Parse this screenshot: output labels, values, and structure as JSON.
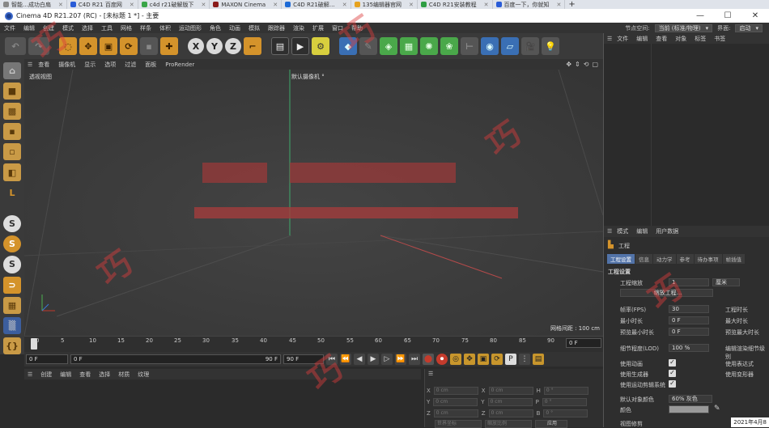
{
  "browser_tabs": [
    {
      "label": "智能…成功白扇",
      "color": "#888"
    },
    {
      "label": "C4D R21 百度网",
      "color": "#2a5cd7"
    },
    {
      "label": "c4d r21破解版下",
      "color": "#3aa548"
    },
    {
      "label": "MAXON Cinema",
      "color": "#8a1c1c"
    },
    {
      "label": "C4D R21破解…",
      "color": "#1e6bd6"
    },
    {
      "label": "135编辑器官网",
      "color": "#e6a21f"
    },
    {
      "label": "C4D R21安装教程",
      "color": "#2f9e44"
    },
    {
      "label": "百度一下，你就知",
      "color": "#2a5cd7"
    }
  ],
  "window": {
    "title": "Cinema 4D R21.207 (RC) - [未标题 1 *] - 主要",
    "minimize": "—",
    "maximize": "☐",
    "close": "✕"
  },
  "menu": [
    "文件",
    "编辑",
    "创建",
    "模式",
    "选择",
    "工具",
    "网格",
    "样条",
    "体积",
    "运动图形",
    "角色",
    "动画",
    "模拟",
    "跟踪器",
    "渲染",
    "扩展",
    "窗口",
    "帮助"
  ],
  "menu_right": {
    "node_label": "节点空间:",
    "node_value": "当前 (标准/物理)",
    "layout_label": "界面:",
    "layout_value": "启动"
  },
  "toolbar": {
    "x": "X",
    "y": "Y",
    "z": "Z"
  },
  "viewport_menu": [
    "查看",
    "摄像机",
    "显示",
    "选项",
    "过滤",
    "面板",
    "ProRender"
  ],
  "viewport": {
    "label": "透视视图",
    "camera": "默认摄像机 °",
    "grid": "网格间距 : 100 cm"
  },
  "timeline": {
    "ticks": [
      "0",
      "5",
      "10",
      "15",
      "20",
      "25",
      "30",
      "35",
      "40",
      "45",
      "50",
      "55",
      "60",
      "65",
      "70",
      "75",
      "80",
      "85",
      "90"
    ],
    "frame": "0 F"
  },
  "transport": {
    "start": "0 F",
    "current": "0 F",
    "end_a": "90 F",
    "end_b": "90 F"
  },
  "material_menu": [
    "创建",
    "编辑",
    "查看",
    "选择",
    "材质",
    "纹理"
  ],
  "coords": {
    "rows": [
      {
        "a": "X",
        "av": "0 cm",
        "b": "X",
        "bv": "0 cm",
        "c": "H",
        "cv": "0 °"
      },
      {
        "a": "Y",
        "av": "0 cm",
        "b": "Y",
        "bv": "0 cm",
        "c": "P",
        "cv": "0 °"
      },
      {
        "a": "Z",
        "av": "0 cm",
        "b": "Z",
        "bv": "0 cm",
        "c": "B",
        "cv": "0 °"
      }
    ],
    "mode_a": "世界坐标",
    "mode_b": "缩放比例",
    "apply": "应用"
  },
  "object_menu": [
    "文件",
    "编辑",
    "查看",
    "对象",
    "标签",
    "书签"
  ],
  "attr_menu": [
    "模式",
    "编辑",
    "用户数据"
  ],
  "attr": {
    "title": "工程",
    "tabs": [
      "工程设置",
      "信息",
      "动力学",
      "参考",
      "待办事项",
      "帧插值"
    ],
    "section": "工程设置",
    "scale_label": "工程缩放",
    "scale_value": "1",
    "scale_unit": "厘米",
    "scale_button": "缩放工程...",
    "fps_label": "帧率(FPS)",
    "fps_value": "30",
    "proj_time": "工程时长",
    "min_time_label": "最小时长",
    "min_time_value": "0 F",
    "max_time": "最大时长",
    "preview_min_label": "预览最小时长",
    "preview_min_value": "0 F",
    "preview_max": "预览最大时长",
    "lod_label": "细节程度(LOD)",
    "lod_value": "100 %",
    "lod_right": "编辑渲染细节级别",
    "use_anim": "使用动画",
    "use_expr": "使用表达式",
    "use_gen": "使用生成器",
    "use_deform": "使用变形器",
    "use_motion": "使用运动剪辑系统",
    "default_color_label": "默认对象颜色",
    "default_color_value": "60% 灰色",
    "color_label": "颜色",
    "view_clip": "视图修剪"
  },
  "datestamp": "2021年4月8",
  "watermark": "巧",
  "check": "✓"
}
